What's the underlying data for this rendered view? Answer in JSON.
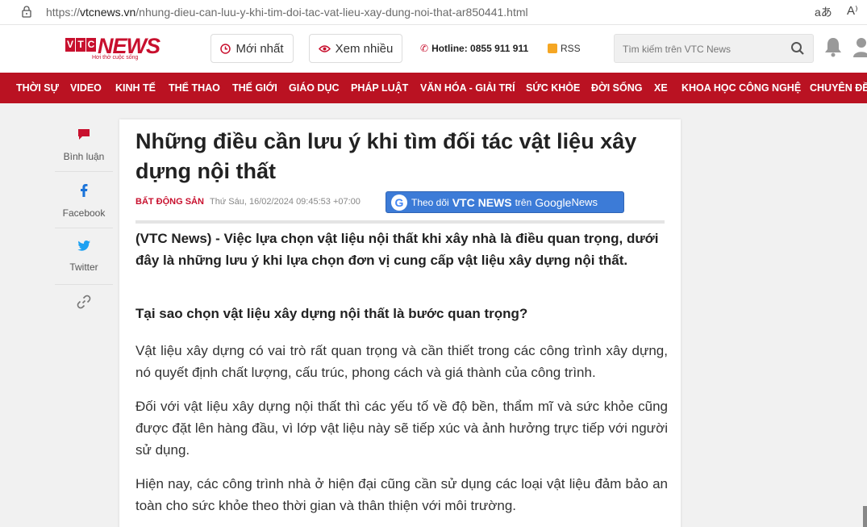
{
  "browser": {
    "url_scheme": "https://",
    "url_host": "vtcnews.vn",
    "url_path": "/nhung-dieu-can-luu-y-khi-tim-doi-tac-vat-lieu-xay-dung-noi-that-ar850441.html",
    "read_aloud_icon": "aあ",
    "font_icon": "A⁾"
  },
  "header": {
    "logo_vtc": [
      "V",
      "T",
      "C"
    ],
    "logo_news": "NEWS",
    "logo_tagline": "Hơi thở cuộc sống",
    "btn_latest": "Mới nhất",
    "btn_most_viewed": "Xem nhiều",
    "hotline": "Hotline: 0855 911 911",
    "rss": "RSS",
    "search_placeholder": "Tìm kiếm trên VTC News"
  },
  "nav": [
    "THỜI SỰ",
    "VIDEO",
    "KINH TẾ",
    "THỂ THAO",
    "THẾ GIỚI",
    "GIÁO DỤC",
    "PHÁP LUẬT",
    "VĂN HÓA - GIẢI TRÍ",
    "SỨC KHỎE",
    "ĐỜI SỐNG",
    "XE",
    "KHOA HỌC CÔNG NGHỆ",
    "CHUYÊN ĐỀ"
  ],
  "share": {
    "comment": "Bình luận",
    "facebook": "Facebook",
    "twitter": "Twitter"
  },
  "article": {
    "title": "Những điều cần lưu ý khi tìm đối tác vật liệu xây dựng nội thất",
    "category": "BẤT ĐỘNG SẢN",
    "date": "Thứ Sáu, 16/02/2024 09:45:53 +07:00",
    "gnews_follow": "Theo dõi",
    "gnews_brand": "VTC NEWS",
    "gnews_on": "trên",
    "gnews_google": "Google",
    "gnews_news": "News",
    "lead": "(VTC News) - Việc lựa chọn vật liệu nội thất khi xây nhà là điều quan trọng, dưới đây là những lưu ý khi lựa chọn đơn vị cung cấp vật liệu xây dựng nội thất.",
    "heading": "Tại sao chọn vật liệu xây dựng nội thất là bước quan trọng?",
    "p1": "Vật liệu xây dựng có vai trò rất quan trọng và cần thiết trong các công trình xây dựng, nó quyết định chất lượng, cấu trúc, phong cách và giá thành của công trình.",
    "p2": "Đối với vật liệu xây dựng nội thất thì các yếu tố về độ bền, thẩm mĩ và sức khỏe cũng được đặt lên hàng đầu, vì lớp vật liệu này sẽ tiếp xúc và ảnh hưởng trực tiếp với người sử dụng.",
    "p3": "Hiện nay, các công trình nhà ở hiện đại cũng cần sử dụng các loại vật liệu đảm bảo an toàn cho sức khỏe theo thời gian và thân thiện với môi trường."
  },
  "colors": {
    "brand_red": "#c8102e",
    "nav_red": "#ba1222",
    "gnews_blue": "#3c7bd7"
  }
}
